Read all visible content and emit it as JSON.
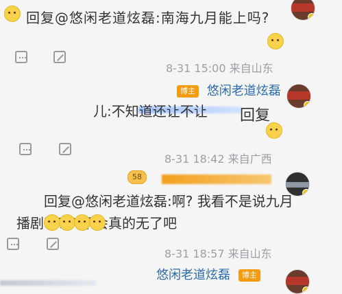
{
  "comments": [
    {
      "id": "c0",
      "top_text": "回复@悠闲老道炫磊:南海九月能上吗?",
      "meta": "8-31 15:00 来自山东",
      "author": "悠闲老道炫磊",
      "badge": "博主"
    },
    {
      "id": "c1",
      "reply_text": "回复",
      "reply_tail": "儿:不知道还让不让",
      "meta": "8-31 18:42 来自广西",
      "author": "悠闲老道炫磊",
      "badge": "博主"
    },
    {
      "id": "c2",
      "reply_line1": "回复@悠闲老道炫磊:啊? 我看不是说九月",
      "reply_line2": "播剧吗? ? 不会真的无了吧",
      "meta": "8-31 18:57 来自山东",
      "tag": "58"
    },
    {
      "id": "c3",
      "author": "悠闲老道炫磊",
      "badge": "博主"
    }
  ],
  "icons": {
    "comment": "comment-icon",
    "share": "share-icon",
    "emoji": "emoji-icon"
  }
}
